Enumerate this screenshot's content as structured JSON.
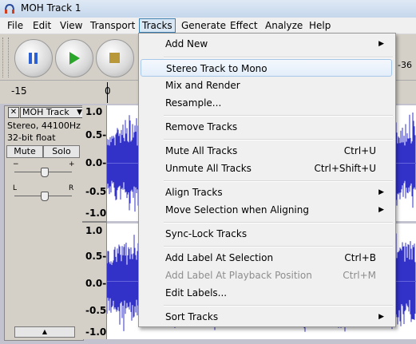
{
  "window": {
    "title": "MOH Track 1"
  },
  "menubar": [
    "File",
    "Edit",
    "View",
    "Transport",
    "Tracks",
    "Generate",
    "Effect",
    "Analyze",
    "Help"
  ],
  "active_menu": "Tracks",
  "toolbar": {
    "pause_icon": "pause-icon",
    "play_icon": "play-icon",
    "stop_icon": "stop-icon",
    "meter_right_label": "-36"
  },
  "ruler": {
    "label_a": "-15",
    "label_b": "0"
  },
  "track": {
    "close": "✕",
    "name": "MOH Track",
    "arrow": "▼",
    "info_line1": "Stereo, 44100Hz",
    "info_line2": "32-bit float",
    "mute": "Mute",
    "solo": "Solo",
    "gain_minus": "−",
    "gain_plus": "+",
    "pan_left": "L",
    "pan_right": "R",
    "collapse": "▲"
  },
  "vruler": [
    "1.0",
    "0.5-",
    "0.0-",
    "-0.5-",
    "-1.0",
    "1.0",
    "0.5-",
    "0.0-",
    "-0.5-",
    "-1.0"
  ],
  "dropdown": {
    "items": [
      {
        "label": "Add New",
        "shortcut": "",
        "submenu": true,
        "disabled": false,
        "highlighted": false
      },
      {
        "label": "Stereo Track to Mono",
        "shortcut": "",
        "submenu": false,
        "disabled": false,
        "highlighted": true
      },
      {
        "label": "Mix and Render",
        "shortcut": "",
        "submenu": false,
        "disabled": false,
        "highlighted": false
      },
      {
        "label": "Resample...",
        "shortcut": "",
        "submenu": false,
        "disabled": false,
        "highlighted": false
      },
      {
        "label": "Remove Tracks",
        "shortcut": "",
        "submenu": false,
        "disabled": false,
        "highlighted": false
      },
      {
        "label": "Mute All Tracks",
        "shortcut": "Ctrl+U",
        "submenu": false,
        "disabled": false,
        "highlighted": false
      },
      {
        "label": "Unmute All Tracks",
        "shortcut": "Ctrl+Shift+U",
        "submenu": false,
        "disabled": false,
        "highlighted": false
      },
      {
        "label": "Align Tracks",
        "shortcut": "",
        "submenu": true,
        "disabled": false,
        "highlighted": false
      },
      {
        "label": "Move Selection when Aligning",
        "shortcut": "",
        "submenu": true,
        "disabled": false,
        "highlighted": false
      },
      {
        "label": "Sync-Lock Tracks",
        "shortcut": "",
        "submenu": false,
        "disabled": false,
        "highlighted": false
      },
      {
        "label": "Add Label At Selection",
        "shortcut": "Ctrl+B",
        "submenu": false,
        "disabled": false,
        "highlighted": false
      },
      {
        "label": "Add Label At Playback Position",
        "shortcut": "Ctrl+M",
        "submenu": false,
        "disabled": true,
        "highlighted": false
      },
      {
        "label": "Edit Labels...",
        "shortcut": "",
        "submenu": false,
        "disabled": false,
        "highlighted": false
      },
      {
        "label": "Sort Tracks",
        "shortcut": "",
        "submenu": true,
        "disabled": false,
        "highlighted": false
      }
    ]
  },
  "colors": {
    "waveform": "#3232c8",
    "waveform_bg": "#ffffff",
    "menu_highlight": "#d9e7f5"
  }
}
